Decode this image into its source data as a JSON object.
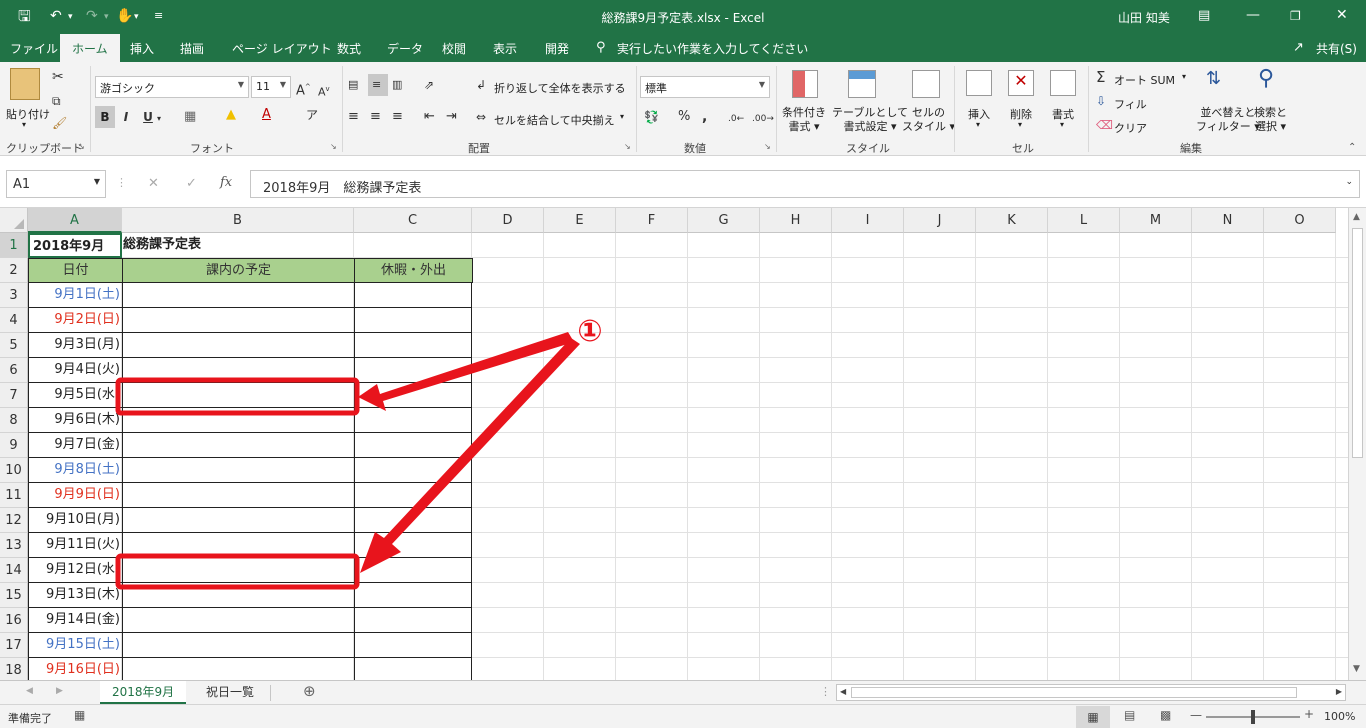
{
  "titlebar": {
    "title": "総務課9月予定表.xlsx  -  Excel",
    "user": "山田 知美",
    "icons": [
      "save-icon",
      "undo-icon",
      "redo-icon",
      "touch-mode-icon",
      "customize-icon",
      "ribbon-display-icon",
      "minimize-icon",
      "restore-icon",
      "close-icon"
    ]
  },
  "tabs": [
    "ファイル",
    "ホーム",
    "挿入",
    "描画",
    "ページ レイアウト",
    "数式",
    "データ",
    "校閲",
    "表示",
    "開発"
  ],
  "tell_me": "実行したい作業を入力してください",
  "share": "共有(S)",
  "ribbon": {
    "clipboard": {
      "paste": "貼り付け",
      "group": "クリップボード"
    },
    "font": {
      "name": "游ゴシック",
      "size": "11",
      "bold": "B",
      "italic": "I",
      "underline": "U",
      "group": "フォント"
    },
    "alignment": {
      "wrap": "折り返して全体を表示する",
      "merge": "セルを結合して中央揃え",
      "group": "配置"
    },
    "number": {
      "format": "標準",
      "percent": "%",
      "comma": ",",
      "group": "数値"
    },
    "styles": {
      "conditional": [
        "条件付き",
        "書式"
      ],
      "table": [
        "テーブルとして",
        "書式設定"
      ],
      "cell_styles": [
        "セルの",
        "スタイル"
      ],
      "group": "スタイル"
    },
    "cells": {
      "insert": "挿入",
      "delete": "削除",
      "format": "書式",
      "group": "セル"
    },
    "editing": {
      "autosum": "オート SUM",
      "fill": "フィル",
      "clear": "クリア",
      "sort": [
        "並べ替えと",
        "フィルター"
      ],
      "find": [
        "検索と",
        "選択"
      ],
      "group": "編集"
    }
  },
  "formula_bar": {
    "name_box": "A1",
    "fx": "fx",
    "content": "2018年9月　総務課予定表"
  },
  "columns": [
    "A",
    "B",
    "C",
    "D",
    "E",
    "F",
    "G",
    "H",
    "I",
    "J",
    "K",
    "L",
    "M",
    "N",
    "O"
  ],
  "rows": [
    "1",
    "2",
    "3",
    "4",
    "5",
    "6",
    "7",
    "8",
    "9",
    "10",
    "11",
    "12",
    "13",
    "14",
    "15",
    "16",
    "17",
    "18"
  ],
  "sheet": {
    "title_a1": "2018年9月",
    "title_b1": "総務課予定表",
    "headers": [
      "日付",
      "課内の予定",
      "休暇・外出"
    ],
    "dates": [
      {
        "text": "9月1日(土)",
        "kind": "sat"
      },
      {
        "text": "9月2日(日)",
        "kind": "sun"
      },
      {
        "text": "9月3日(月)",
        "kind": "wd"
      },
      {
        "text": "9月4日(火)",
        "kind": "wd"
      },
      {
        "text": "9月5日(水)",
        "kind": "wd"
      },
      {
        "text": "9月6日(木)",
        "kind": "wd"
      },
      {
        "text": "9月7日(金)",
        "kind": "wd"
      },
      {
        "text": "9月8日(土)",
        "kind": "sat"
      },
      {
        "text": "9月9日(日)",
        "kind": "sun"
      },
      {
        "text": "9月10日(月)",
        "kind": "wd"
      },
      {
        "text": "9月11日(火)",
        "kind": "wd"
      },
      {
        "text": "9月12日(水)",
        "kind": "wd"
      },
      {
        "text": "9月13日(木)",
        "kind": "wd"
      },
      {
        "text": "9月14日(金)",
        "kind": "wd"
      },
      {
        "text": "9月15日(土)",
        "kind": "sat"
      },
      {
        "text": "9月16日(日)",
        "kind": "sun"
      }
    ],
    "colors": {
      "header_fill": "#a9d08e",
      "sat": "#4472c4",
      "sun": "#e0301e",
      "annotation": "#e8141c"
    }
  },
  "annotation": {
    "label": "①"
  },
  "sheet_tabs": [
    "2018年9月",
    "祝日一覧"
  ],
  "status": {
    "ready": "準備完了",
    "zoom": "100%"
  }
}
